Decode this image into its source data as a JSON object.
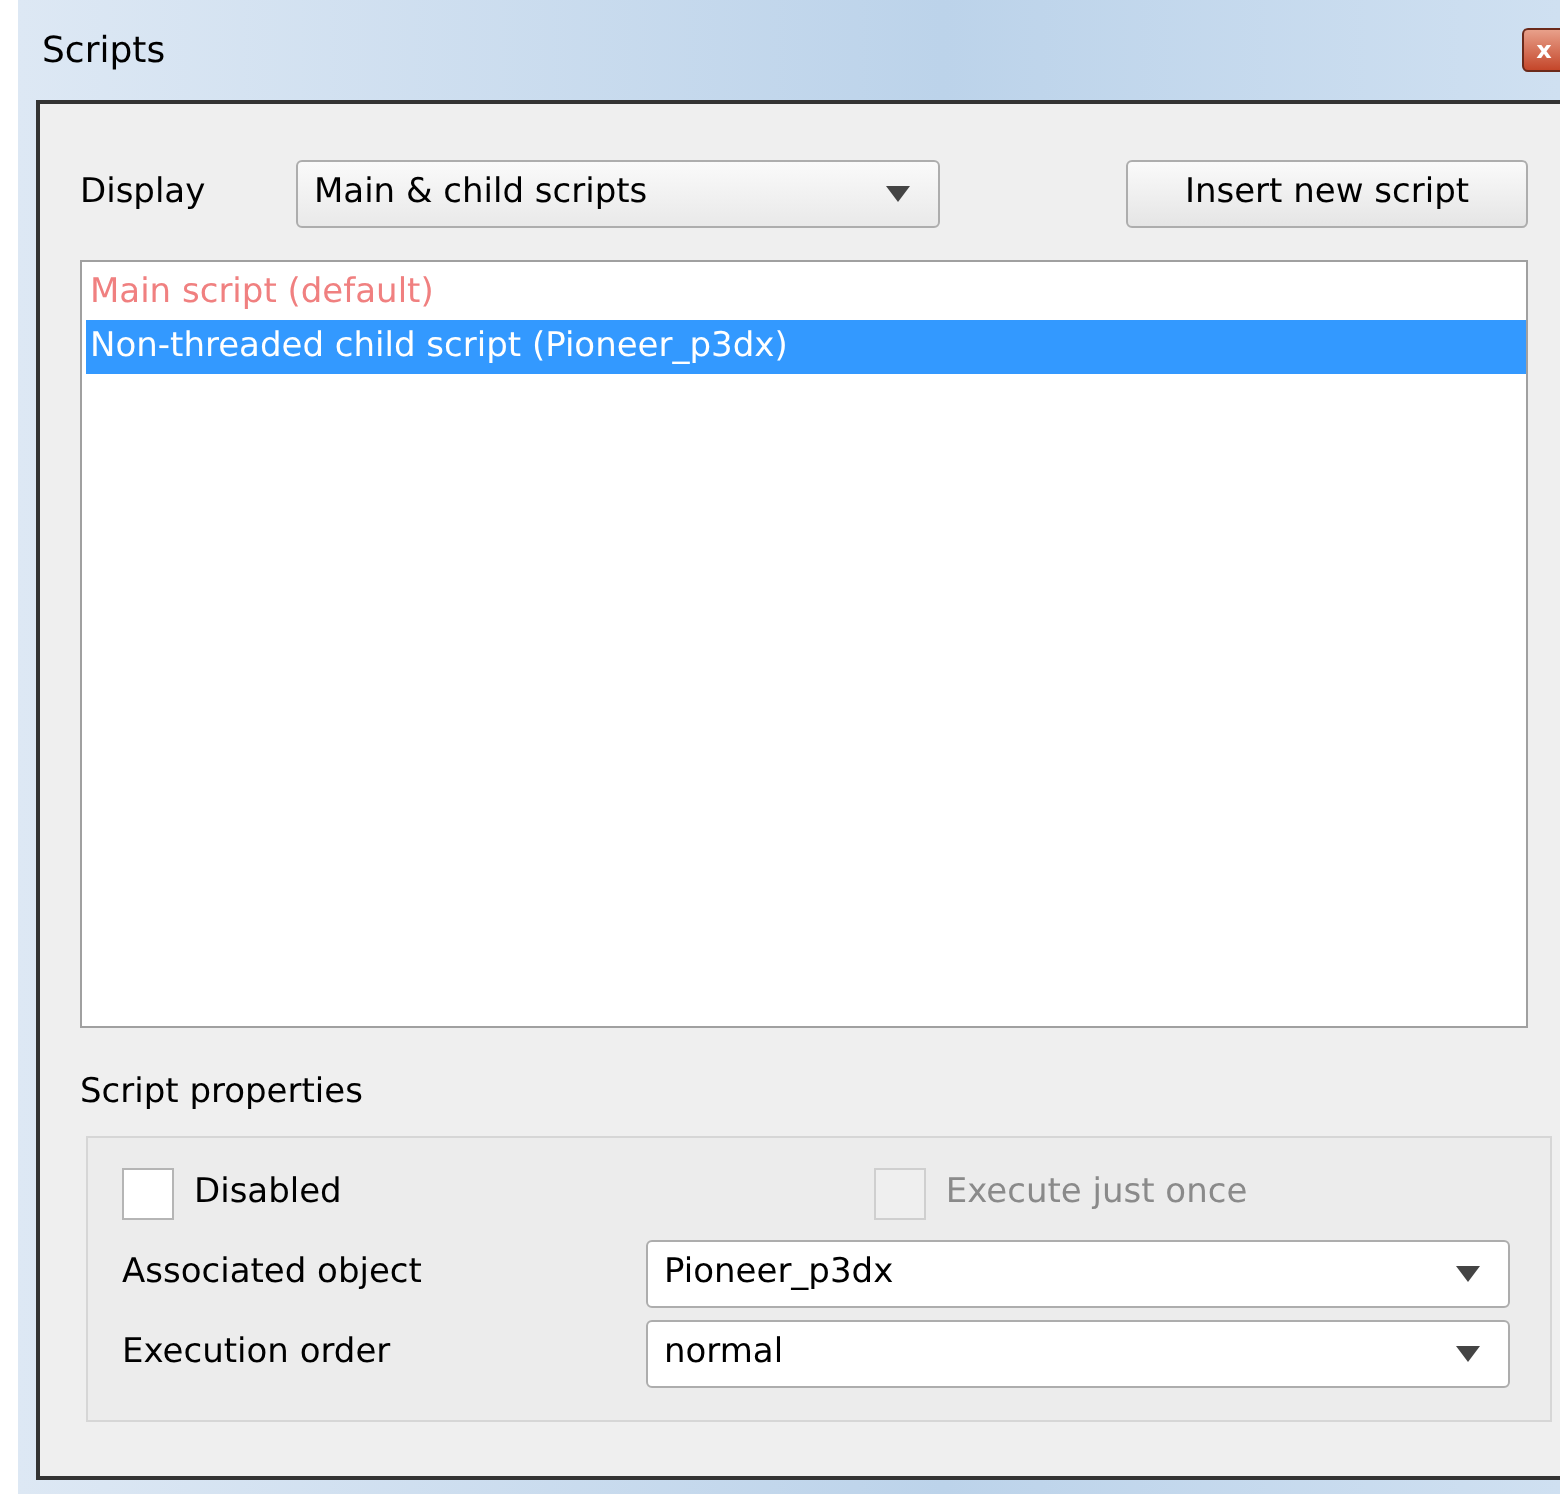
{
  "window": {
    "title": "Scripts",
    "close": "x"
  },
  "display": {
    "label": "Display",
    "value": "Main & child scripts"
  },
  "insert_button": "Insert new script",
  "scripts": [
    {
      "label": "Main script (default)",
      "kind": "main",
      "selected": false
    },
    {
      "label": "Non-threaded child script (Pioneer_p3dx)",
      "kind": "child",
      "selected": true
    }
  ],
  "properties": {
    "title": "Script properties",
    "checkboxes": [
      {
        "label": "Disabled",
        "checked": false,
        "disabled": false
      },
      {
        "label": "Execute just once",
        "checked": false,
        "disabled": true
      }
    ],
    "fields": [
      {
        "label": "Associated object",
        "value": "Pioneer_p3dx"
      },
      {
        "label": "Execution order",
        "value": "normal"
      }
    ]
  }
}
